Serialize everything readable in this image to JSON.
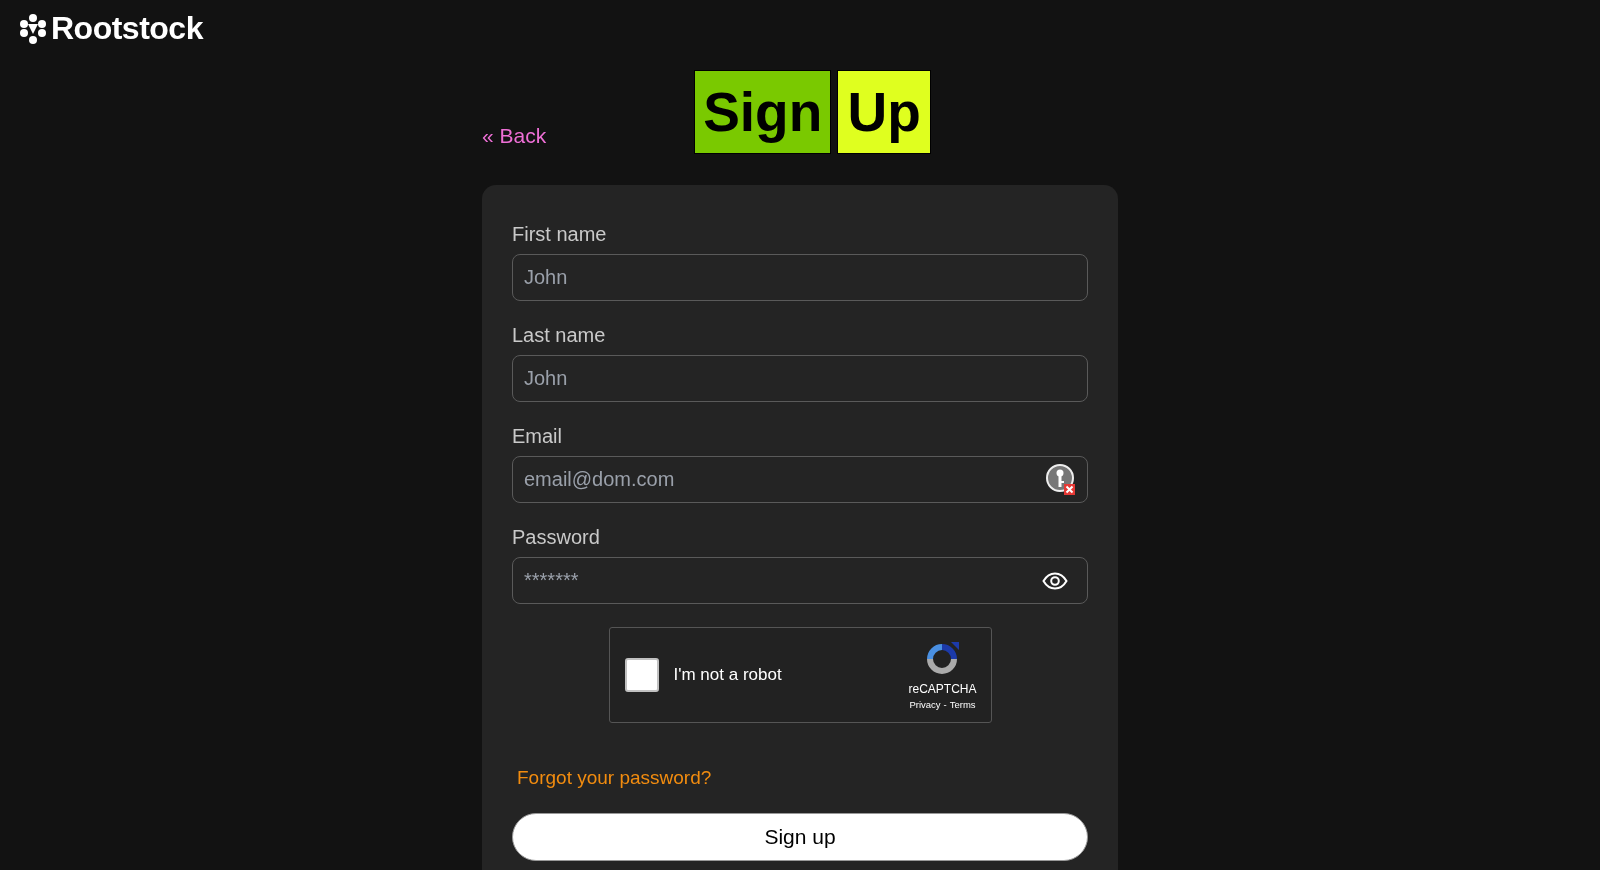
{
  "brand": {
    "name": "Rootstock"
  },
  "back_link": {
    "icon": "«",
    "label": "Back"
  },
  "title": [
    "Sign",
    "Up"
  ],
  "fields": [
    {
      "label": "First name",
      "placeholder": "John",
      "kind": "text"
    },
    {
      "label": "Last name",
      "placeholder": "John",
      "kind": "text"
    },
    {
      "label": "Email",
      "placeholder": "email@dom.com",
      "kind": "email"
    },
    {
      "label": "Password",
      "placeholder": "*******",
      "kind": "password"
    }
  ],
  "captcha": {
    "label": "I'm not a robot",
    "checked": false,
    "brand": "reCAPTCHA",
    "privacy": "Privacy",
    "separator": "-",
    "terms": "Terms"
  },
  "forgot_link": "Forgot your password?",
  "submit_button": "Sign up"
}
